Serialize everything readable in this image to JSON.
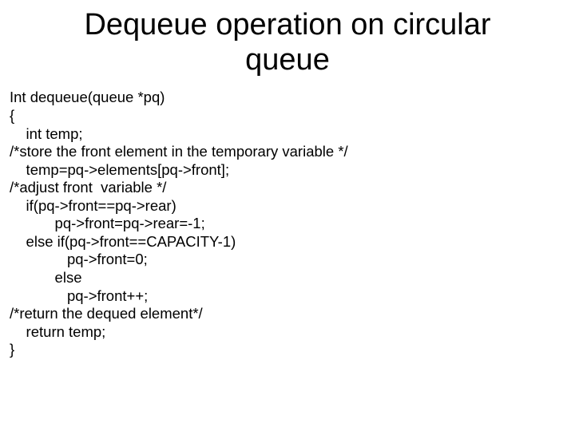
{
  "title_line1": "Dequeue operation on circular",
  "title_line2": "queue",
  "code": {
    "l1": "Int dequeue(queue *pq)",
    "l2": "{",
    "l3": "    int temp;",
    "l4": "/*store the front element in the temporary variable */",
    "l5": "    temp=pq->elements[pq->front];",
    "l6": "/*adjust front  variable */",
    "l7": "    if(pq->front==pq->rear)",
    "l8": "           pq->front=pq->rear=-1;",
    "l9": "    else if(pq->front==CAPACITY-1)",
    "l10": "              pq->front=0;",
    "l11": "           else",
    "l12": "              pq->front++;",
    "l13": "/*return the dequed element*/",
    "l14": "    return temp;",
    "l15": "}"
  }
}
